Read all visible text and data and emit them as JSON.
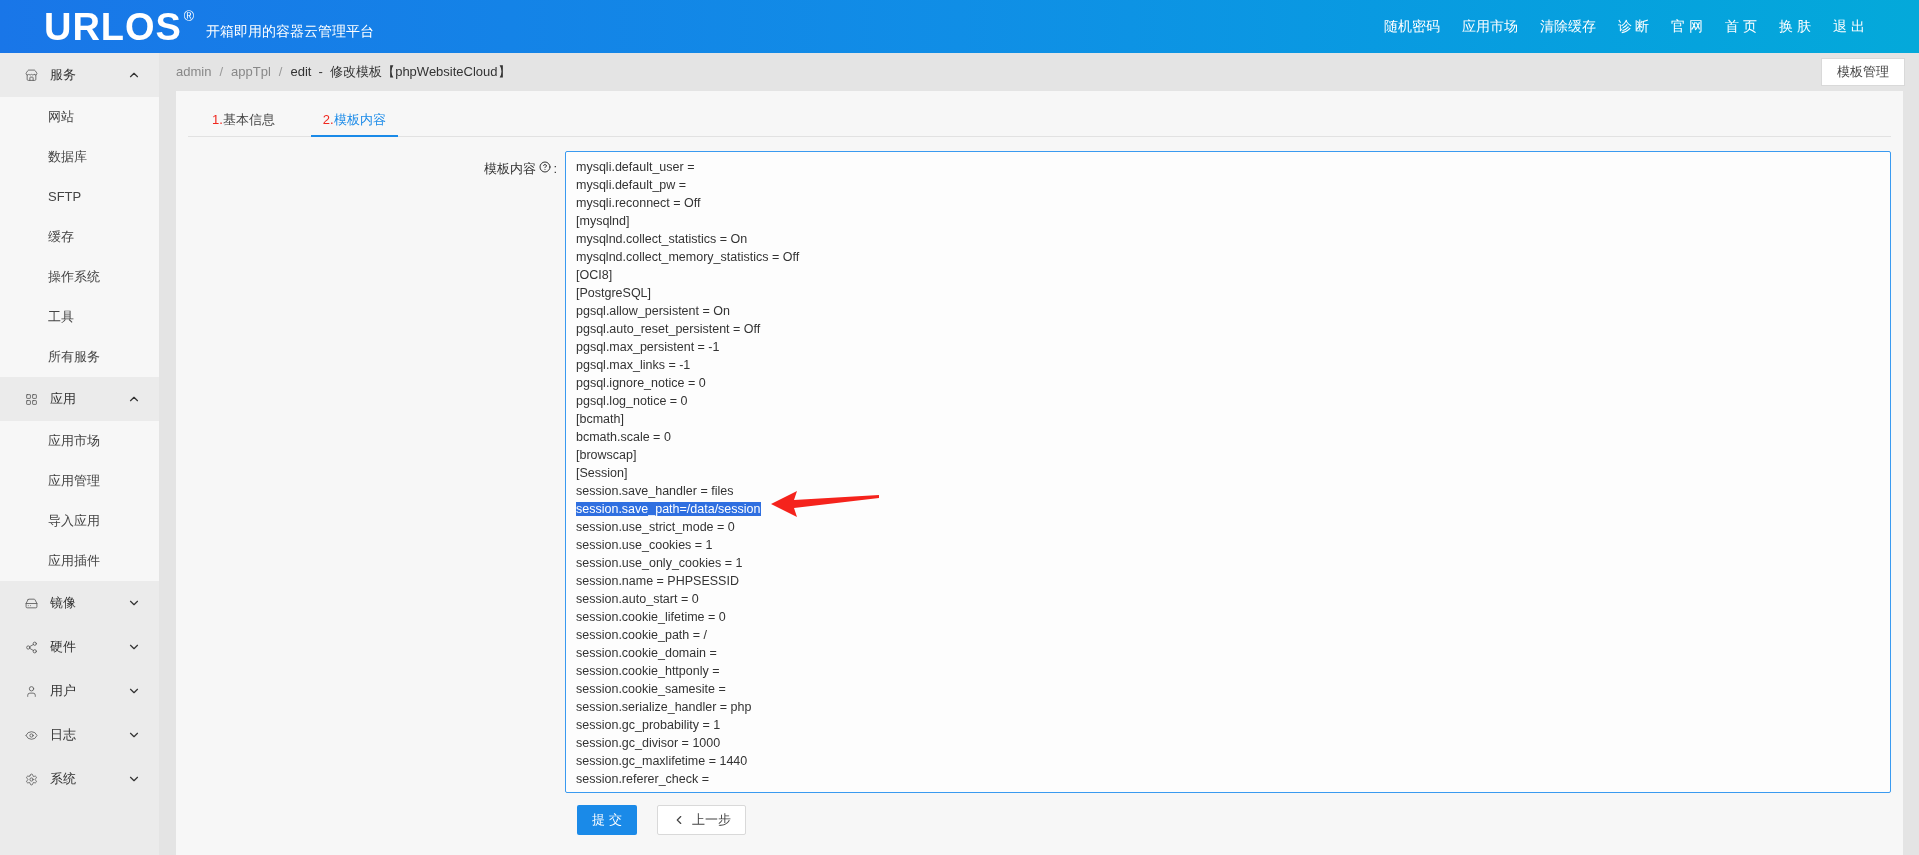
{
  "header": {
    "logo": "URLOS",
    "logo_mark": "®",
    "tagline": "开箱即用的容器云管理平台",
    "nav": [
      "随机密码",
      "应用市场",
      "清除缓存",
      "诊 断",
      "官 网",
      "首 页",
      "换 肤",
      "退 出"
    ]
  },
  "sidebar": {
    "groups": [
      {
        "label": "服务",
        "expanded": true,
        "children": [
          "网站",
          "数据库",
          "SFTP",
          "缓存",
          "操作系统",
          "工具",
          "所有服务"
        ]
      },
      {
        "label": "应用",
        "expanded": true,
        "children": [
          "应用市场",
          "应用管理",
          "导入应用",
          "应用插件"
        ]
      },
      {
        "label": "镜像",
        "expanded": false
      },
      {
        "label": "硬件",
        "expanded": false
      },
      {
        "label": "用户",
        "expanded": false
      },
      {
        "label": "日志",
        "expanded": false
      },
      {
        "label": "系统",
        "expanded": false
      }
    ]
  },
  "breadcrumb": [
    "admin",
    "/",
    "appTpl",
    "/",
    "edit  -  修改模板【phpWebsiteCloud】"
  ],
  "top_button": "模板管理",
  "tabs": [
    {
      "number": "1.",
      "label": "基本信息",
      "selected": false
    },
    {
      "number": "2.",
      "label": "模板内容",
      "selected": true
    }
  ],
  "form": {
    "label": "模板内容",
    "colon": ":",
    "lines": [
      {
        "text": "mysqli.default_user =",
        "selected": false
      },
      {
        "text": "mysqli.default_pw =",
        "selected": false
      },
      {
        "text": "mysqli.reconnect = Off",
        "selected": false
      },
      {
        "text": "[mysqlnd]",
        "selected": false
      },
      {
        "text": "mysqlnd.collect_statistics = On",
        "selected": false
      },
      {
        "text": "mysqlnd.collect_memory_statistics = Off",
        "selected": false
      },
      {
        "text": "[OCI8]",
        "selected": false
      },
      {
        "text": "[PostgreSQL]",
        "selected": false
      },
      {
        "text": "pgsql.allow_persistent = On",
        "selected": false
      },
      {
        "text": "pgsql.auto_reset_persistent = Off",
        "selected": false
      },
      {
        "text": "pgsql.max_persistent = -1",
        "selected": false
      },
      {
        "text": "pgsql.max_links = -1",
        "selected": false
      },
      {
        "text": "pgsql.ignore_notice = 0",
        "selected": false
      },
      {
        "text": "pgsql.log_notice = 0",
        "selected": false
      },
      {
        "text": "[bcmath]",
        "selected": false
      },
      {
        "text": "bcmath.scale = 0",
        "selected": false
      },
      {
        "text": "[browscap]",
        "selected": false
      },
      {
        "text": "[Session]",
        "selected": false
      },
      {
        "text": "session.save_handler = files",
        "selected": false
      },
      {
        "text": "session.save_path=/data/session",
        "selected": true
      },
      {
        "text": "session.use_strict_mode = 0",
        "selected": false
      },
      {
        "text": "session.use_cookies = 1",
        "selected": false
      },
      {
        "text": "session.use_only_cookies = 1",
        "selected": false
      },
      {
        "text": "session.name = PHPSESSID",
        "selected": false
      },
      {
        "text": "session.auto_start = 0",
        "selected": false
      },
      {
        "text": "session.cookie_lifetime = 0",
        "selected": false
      },
      {
        "text": "session.cookie_path = /",
        "selected": false
      },
      {
        "text": "session.cookie_domain =",
        "selected": false
      },
      {
        "text": "session.cookie_httponly =",
        "selected": false
      },
      {
        "text": "session.cookie_samesite =",
        "selected": false
      },
      {
        "text": "session.serialize_handler = php",
        "selected": false
      },
      {
        "text": "session.gc_probability = 1",
        "selected": false
      },
      {
        "text": "session.gc_divisor = 1000",
        "selected": false
      },
      {
        "text": "session.gc_maxlifetime = 1440",
        "selected": false
      },
      {
        "text": "session.referer_check =",
        "selected": false
      }
    ]
  },
  "actions": {
    "submit": "提 交",
    "back": "上一步"
  }
}
